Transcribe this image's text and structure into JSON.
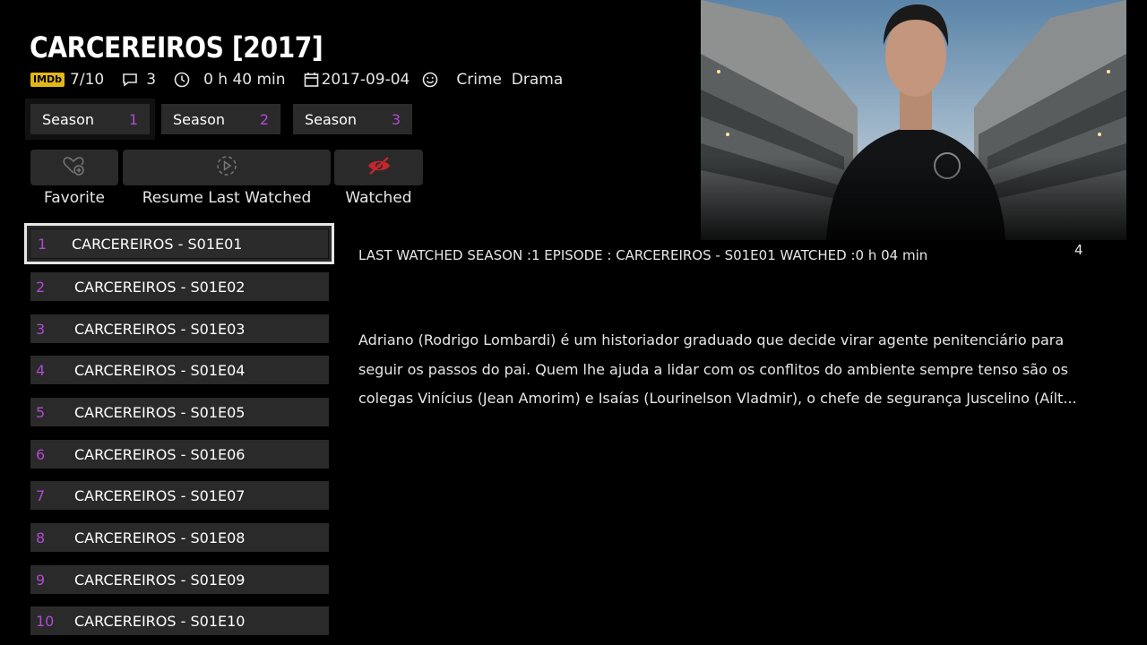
{
  "show": {
    "title": "CARCEREIROS [2017]",
    "rating_badge": "IMDb",
    "rating": "7/10",
    "comments": "3",
    "duration": "0 h 40 min",
    "date": "2017-09-04",
    "genres": "Crime  Drama"
  },
  "seasons": [
    {
      "label": "Season",
      "number": "1",
      "selected": true
    },
    {
      "label": "Season",
      "number": "2",
      "selected": false
    },
    {
      "label": "Season",
      "number": "3",
      "selected": false
    }
  ],
  "actions": {
    "favorite": "Favorite",
    "resume": "Resume Last Watched",
    "watched": "Watched"
  },
  "episodes": [
    {
      "num": "1",
      "title": "CARCEREIROS - S01E01"
    },
    {
      "num": "2",
      "title": "CARCEREIROS - S01E02"
    },
    {
      "num": "3",
      "title": "CARCEREIROS - S01E03"
    },
    {
      "num": "4",
      "title": "CARCEREIROS - S01E04"
    },
    {
      "num": "5",
      "title": "CARCEREIROS - S01E05"
    },
    {
      "num": "6",
      "title": "CARCEREIROS - S01E06"
    },
    {
      "num": "7",
      "title": "CARCEREIROS - S01E07"
    },
    {
      "num": "8",
      "title": "CARCEREIROS - S01E08"
    },
    {
      "num": "9",
      "title": "CARCEREIROS - S01E09"
    },
    {
      "num": "10",
      "title": "CARCEREIROS - S01E10"
    }
  ],
  "detail": {
    "last_watched": "LAST WATCHED SEASON :1  EPISODE : CARCEREIROS - S01E01  WATCHED :0 h 04 min",
    "counter": "4",
    "description": "Adriano (Rodrigo Lombardi) é um historiador graduado que decide virar agente penitenciário para seguir os passos do pai. Quem lhe ajuda a lidar com os conflitos do ambiente sempre tenso são os colegas Vinícius (Jean Amorim) e Isaías (Lourinelson Vladmir), o chefe de segurança Juscelino (Aílt..."
  },
  "colors": {
    "accent": "#b04ad0",
    "imdb": "#e2b616",
    "button_bg": "#2a2a2a",
    "watched_icon": "#c4262e"
  },
  "icons": [
    "comment-icon",
    "clock-icon",
    "calendar-icon",
    "smiley-icon",
    "heart-plus-icon",
    "play-circle-icon",
    "eye-off-icon"
  ]
}
